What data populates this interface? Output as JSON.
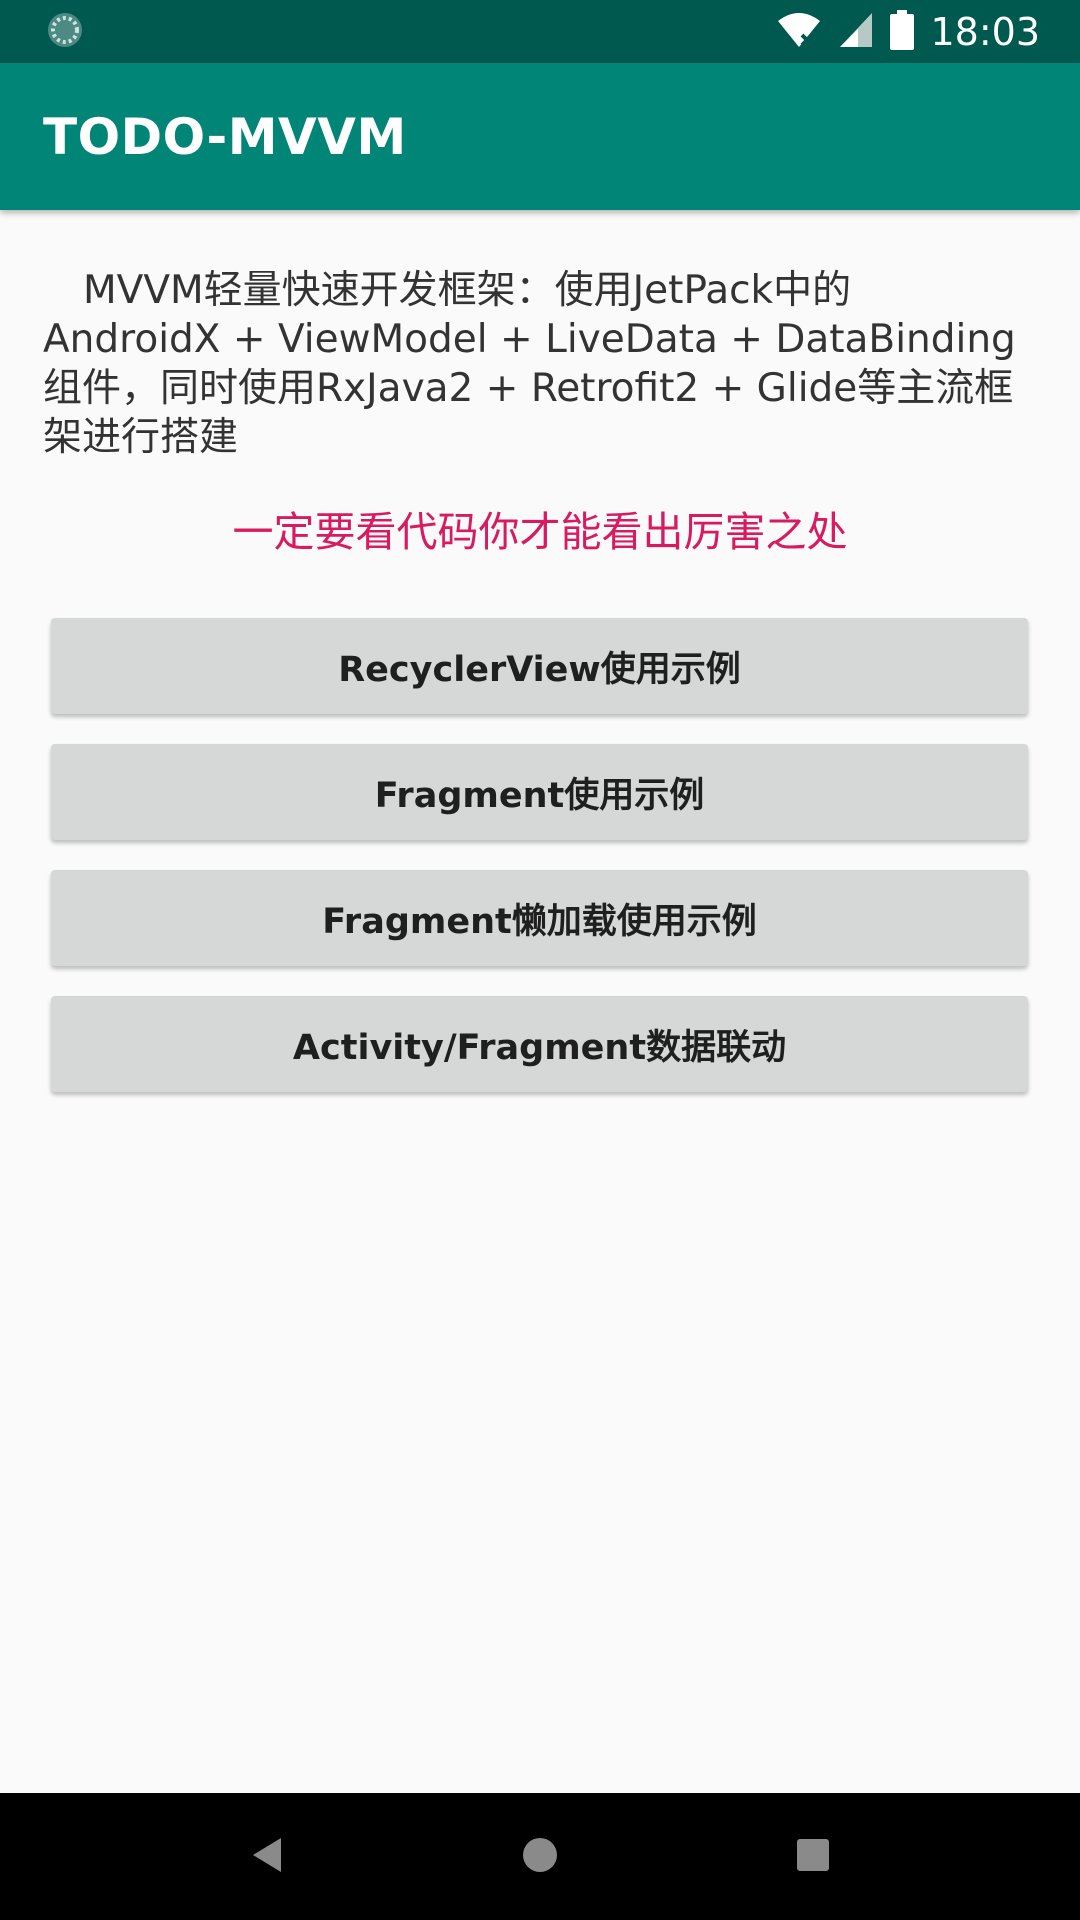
{
  "status_bar": {
    "time": "18:03",
    "icons": [
      "loading-spinner-icon",
      "wifi-off-icon",
      "signal-icon",
      "battery-icon"
    ],
    "color": "#00594f"
  },
  "app_bar": {
    "title": "TODO-MVVM",
    "color": "#008577"
  },
  "main": {
    "description": "MVVM轻量快速开发框架：使用JetPack中的AndroidX + ViewModel + LiveData + DataBinding组件，同时使用RxJava2 + Retrofit2 + Glide等主流框架进行搭建",
    "highlight": "一定要看代码你才能看出厉害之处",
    "highlight_color": "#d81b60",
    "buttons": [
      {
        "label": "RecyclerView使用示例"
      },
      {
        "label": "Fragment使用示例"
      },
      {
        "label": "Fragment懒加载使用示例"
      },
      {
        "label": "Activity/Fragment数据联动"
      }
    ]
  },
  "nav_bar": {
    "items": [
      "back-icon",
      "home-icon",
      "recents-icon"
    ]
  }
}
